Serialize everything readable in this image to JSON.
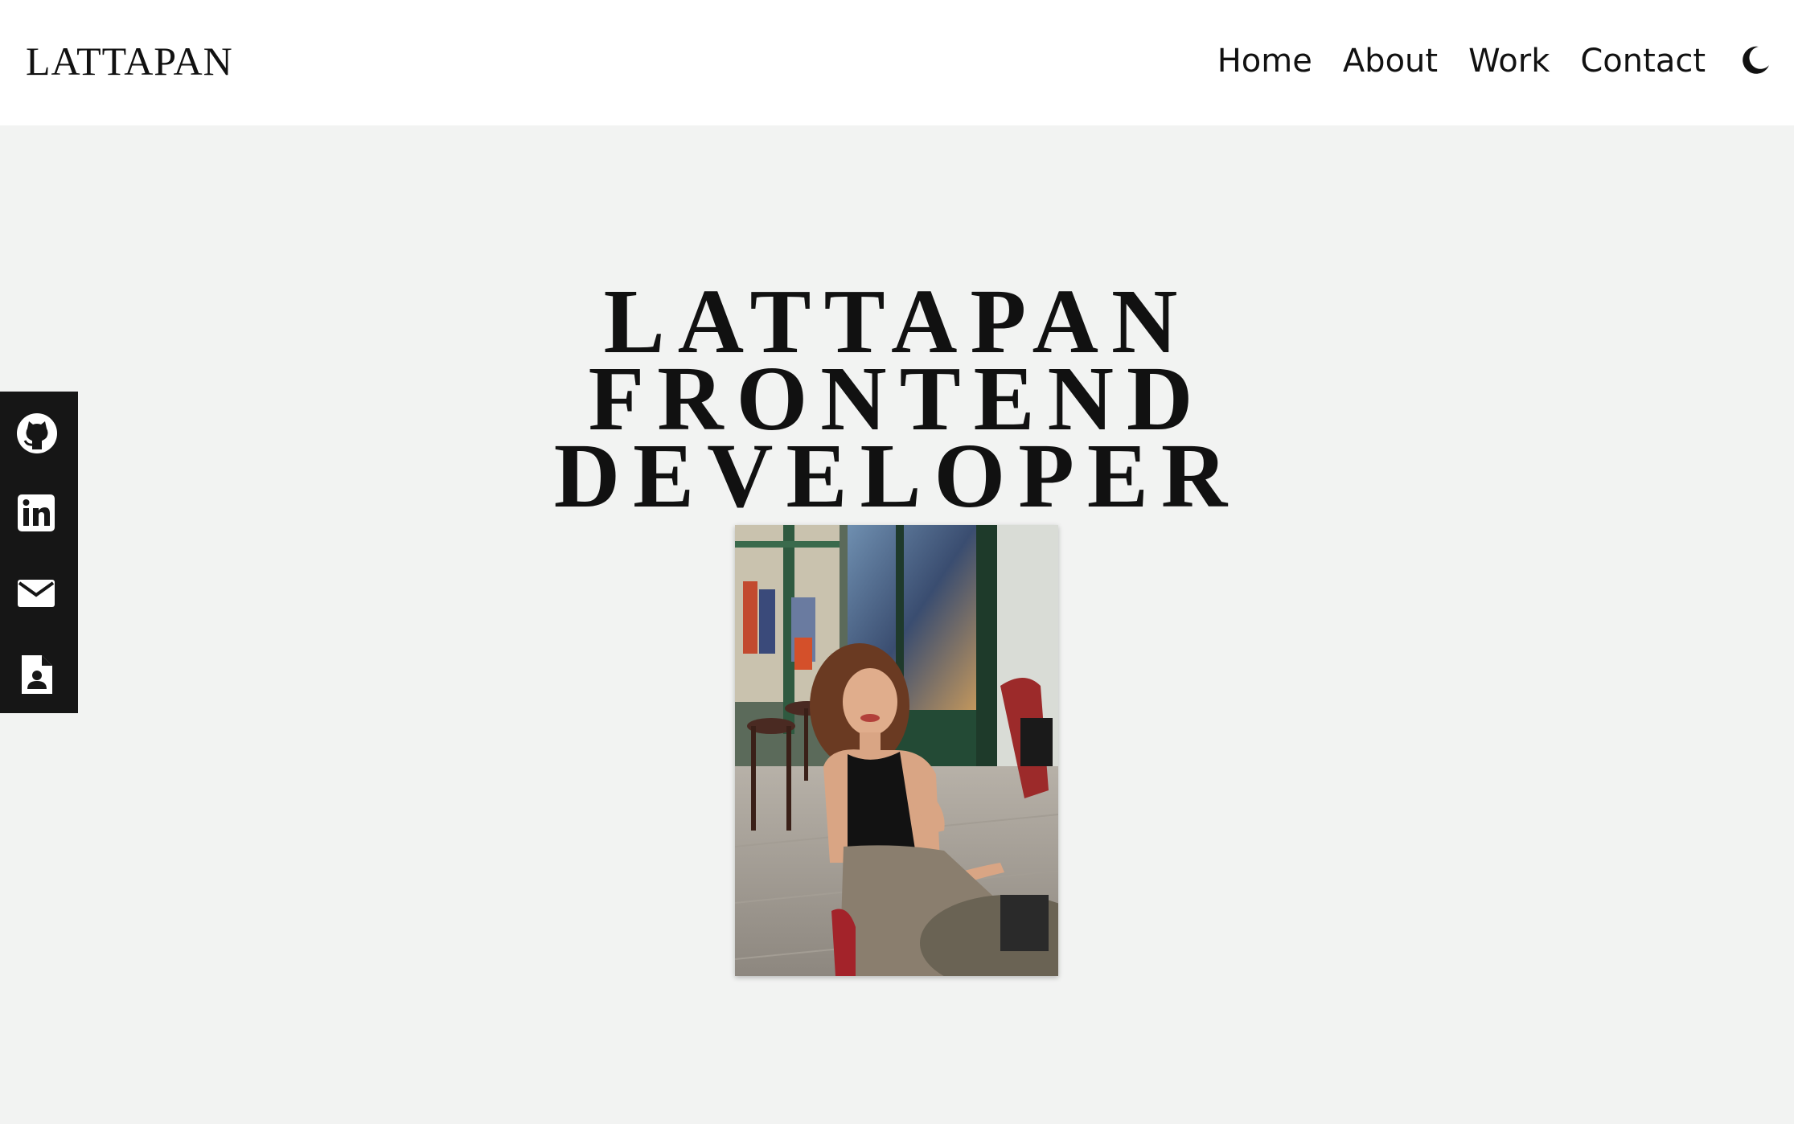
{
  "header": {
    "logo": "LATTAPAN",
    "nav": [
      "Home",
      "About",
      "Work",
      "Contact"
    ],
    "theme_icon": "moon-icon"
  },
  "social": {
    "icons": [
      "github-icon",
      "linkedin-icon",
      "mail-icon",
      "resume-icon"
    ]
  },
  "hero": {
    "lines": [
      "LATTAPAN",
      "FRONTEND",
      "DEVELOPER"
    ],
    "photo": "portrait-photo"
  },
  "colors": {
    "page_bg": "#f2f3f2",
    "header_bg": "#ffffff",
    "sidebar_bg": "#161616",
    "text": "#111111"
  }
}
